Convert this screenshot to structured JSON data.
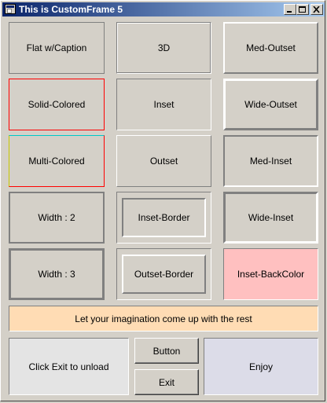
{
  "window": {
    "title": "This is CustomFrame 5"
  },
  "frames": {
    "flat_caption": "Flat w/Caption",
    "three_d": "3D",
    "med_outset": "Med-Outset",
    "solid_colored": "Solid-Colored",
    "inset": "Inset",
    "wide_outset": "Wide-Outset",
    "multi_colored": "Multi-Colored",
    "outset": "Outset",
    "med_inset": "Med-Inset",
    "width2": "Width : 2",
    "inset_border": "Inset-Border",
    "wide_inset": "Wide-Inset",
    "width3": "Width : 3",
    "outset_border": "Outset-Border",
    "inset_backcolor": "Inset-BackColor"
  },
  "banner": "Let your imagination come up with the rest",
  "bottom": {
    "exit_info": "Click Exit to unload",
    "button_label": "Button",
    "exit_label": "Exit",
    "enjoy": "Enjoy"
  },
  "colors": {
    "face": "#d4d0c8",
    "titlebar_start": "#0a246a",
    "titlebar_end": "#a6caf0",
    "banner_bg": "#ffdcb4",
    "inset_backcolor_bg": "#ffc0c0",
    "exit_info_bg": "#e4e4e4",
    "enjoy_bg": "#dcdce8"
  },
  "icons": [
    "app-icon",
    "minimize-icon",
    "maximize-icon",
    "close-icon"
  ]
}
